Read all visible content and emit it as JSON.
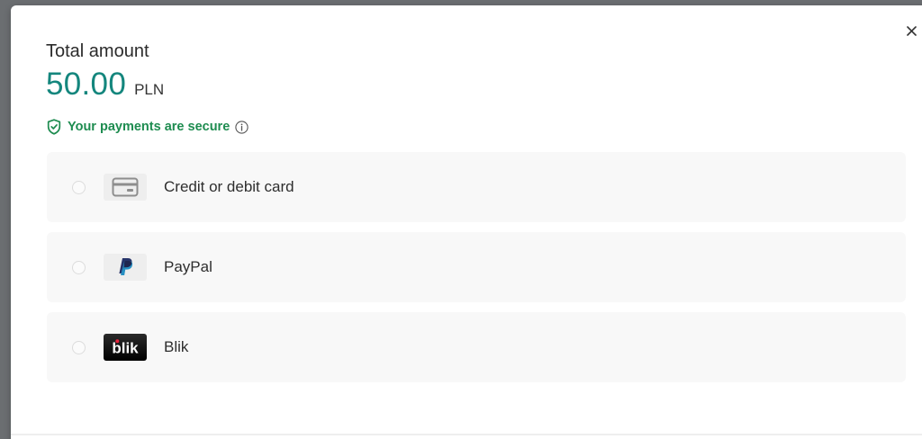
{
  "summary": {
    "title": "Total amount",
    "amount": "50.00",
    "currency": "PLN",
    "secure_text": "Your payments are secure"
  },
  "methods": [
    {
      "label": "Credit or debit card",
      "icon": "credit-card-icon"
    },
    {
      "label": "PayPal",
      "icon": "paypal-icon"
    },
    {
      "label": "Blik",
      "icon": "blik-icon"
    }
  ],
  "colors": {
    "accent": "#14867d",
    "secure": "#1e8c50",
    "row_background": "#f8f8f8",
    "backdrop": "#6b6e71"
  },
  "icons": {
    "close": "close-icon",
    "shield": "shield-check-icon",
    "info": "info-icon"
  }
}
